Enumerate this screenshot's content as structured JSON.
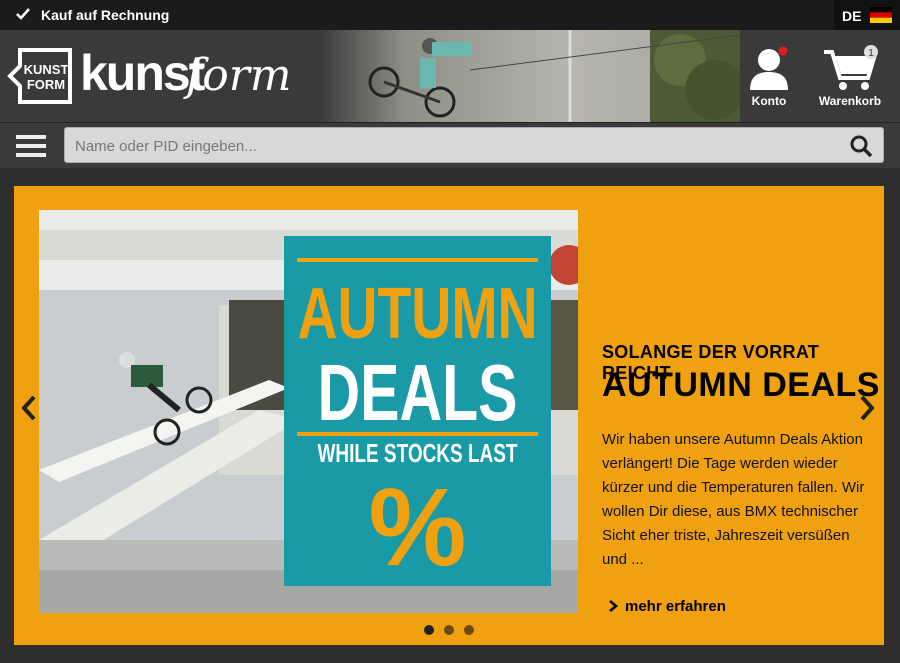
{
  "topbar": {
    "invoice_label": "Kauf auf Rechnung",
    "language": "DE"
  },
  "header": {
    "logo_badge_line1": "KUNST",
    "logo_badge_line2": "FORM",
    "logo_word": "kunst",
    "logo_script": "form",
    "account_label": "Konto",
    "cart_label": "Warenkorb",
    "cart_count": "1"
  },
  "search": {
    "placeholder": "Name oder PID eingeben..."
  },
  "banner": {
    "image_text_1": "AUTUMN",
    "image_text_2": "DEALS",
    "image_text_3": "WHILE STOCKS LAST",
    "image_text_4": "%",
    "kicker": "SOLANGE DER VORRAT REICHT",
    "headline": "AUTUMN DEALS",
    "description": "Wir haben unsere Autumn Deals Aktion verlängert! Die Tage werden wieder kürzer und die Temperaturen fallen. Wir wollen Dir diese, aus BMX technischer Sicht eher triste, Jahreszeit versüßen und ...",
    "more_label": "mehr erfahren",
    "slides": 3,
    "active_slide": 1
  },
  "colors": {
    "banner_bg": "#efa10f",
    "teal": "#1a9aa6",
    "dark": "#2b2b2b"
  },
  "icons": [
    "check-icon",
    "flag-de-icon",
    "user-icon",
    "cart-icon",
    "menu-icon",
    "search-icon",
    "chevron-left-icon",
    "chevron-right-icon",
    "chevron-right-small-icon"
  ]
}
